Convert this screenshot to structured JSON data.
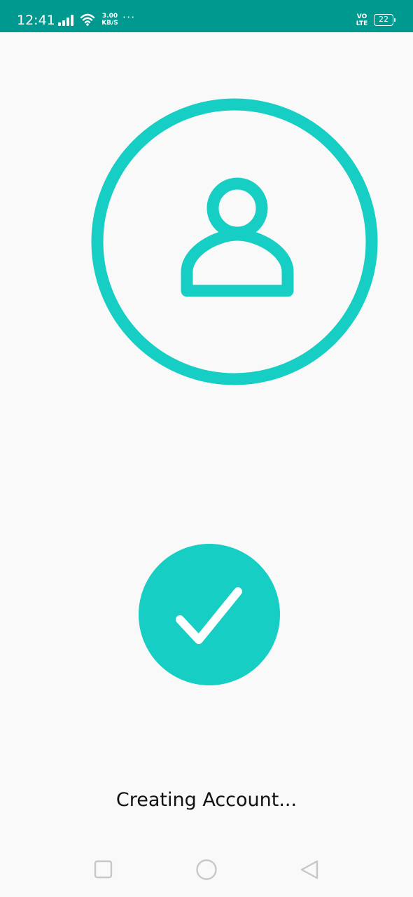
{
  "status_bar": {
    "time": "12:41",
    "speed_value": "3.00",
    "speed_unit": "KB/S",
    "more": "···",
    "volte_top": "VO",
    "volte_bottom": "LTE",
    "battery": "22",
    "background": "#00998f"
  },
  "avatar": {
    "icon": "user-icon",
    "ring_color": "#16cec4"
  },
  "success": {
    "icon": "check-icon",
    "color": "#16cec4"
  },
  "status_text": "Creating Account...",
  "nav_bar": {
    "recents_icon": "square-icon",
    "home_icon": "circle-icon",
    "back_icon": "triangle-back-icon"
  }
}
